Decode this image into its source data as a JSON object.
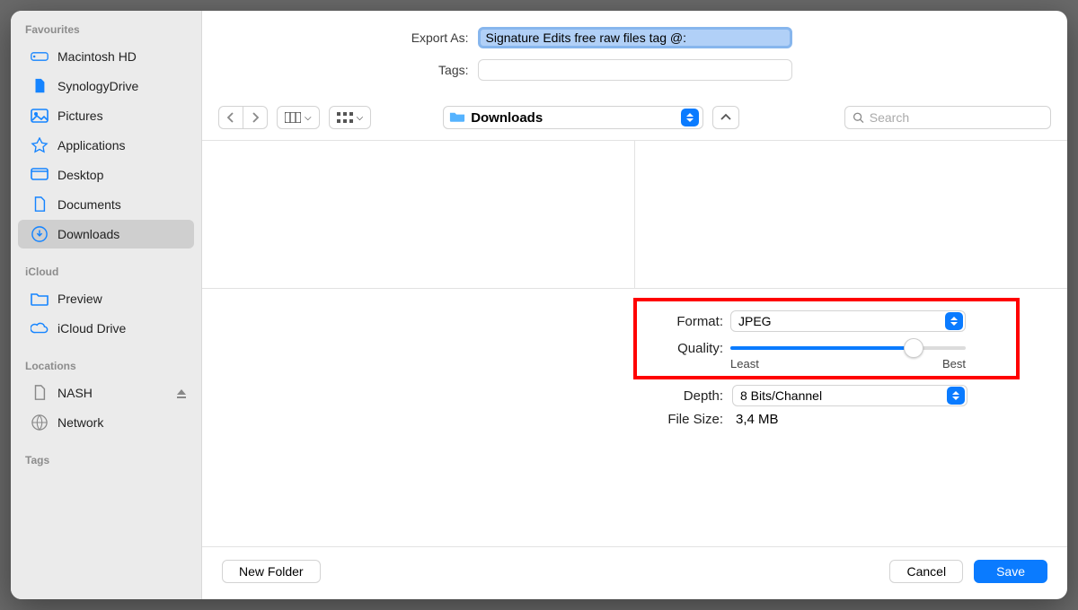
{
  "exportAsLabel": "Export As:",
  "exportAsValue": "Signature Edits free raw files tag @:",
  "tagsLabel": "Tags:",
  "tagsValue": "",
  "sidebar": {
    "favouritesTitle": "Favourites",
    "icloudTitle": "iCloud",
    "locationsTitle": "Locations",
    "tagsTitle": "Tags",
    "items": [
      {
        "label": "Macintosh HD"
      },
      {
        "label": "SynologyDrive"
      },
      {
        "label": "Pictures"
      },
      {
        "label": "Applications"
      },
      {
        "label": "Desktop"
      },
      {
        "label": "Documents"
      },
      {
        "label": "Downloads"
      }
    ],
    "icloudItems": [
      {
        "label": "Preview"
      },
      {
        "label": "iCloud Drive"
      }
    ],
    "locations": [
      {
        "label": "NASH"
      },
      {
        "label": "Network"
      }
    ]
  },
  "folderPopup": "Downloads",
  "searchPlaceholder": "Search",
  "options": {
    "formatLabel": "Format:",
    "formatValue": "JPEG",
    "qualityLabel": "Quality:",
    "qualityPercent": 78,
    "leastLabel": "Least",
    "bestLabel": "Best",
    "depthLabel": "Depth:",
    "depthValue": "8 Bits/Channel",
    "fileSizeLabel": "File Size:",
    "fileSizeValue": "3,4 MB"
  },
  "footer": {
    "newFolder": "New Folder",
    "cancel": "Cancel",
    "save": "Save"
  }
}
